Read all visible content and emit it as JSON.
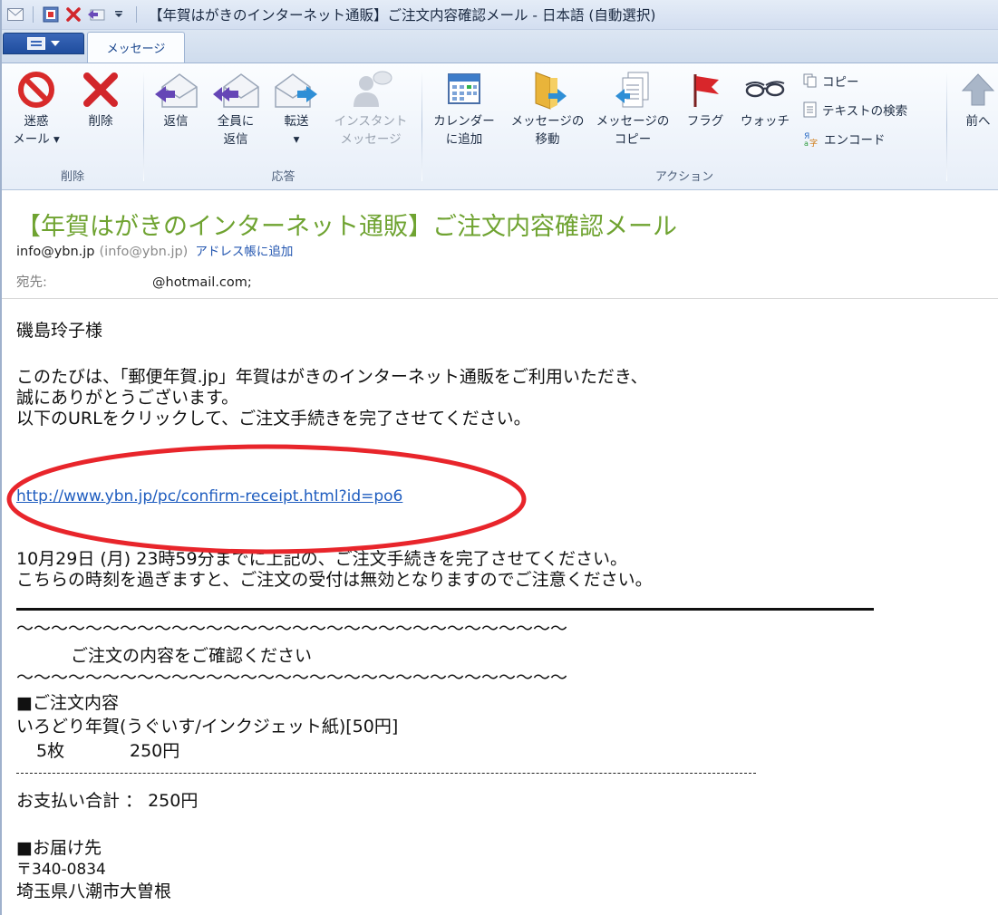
{
  "window": {
    "title": "【年賀はがきのインターネット通販】ご注文内容確認メール - 日本語 (自動選択)"
  },
  "tabs": {
    "message_tab": "メッセージ"
  },
  "ribbon": {
    "groups": {
      "delete": "削除",
      "respond": "応答",
      "actions": "アクション"
    },
    "buttons": {
      "junk_line1": "迷惑",
      "junk_line2": "メール ▾",
      "delete": "削除",
      "reply": "返信",
      "reply_all_line1": "全員に",
      "reply_all_line2": "返信",
      "forward_line1": "転送",
      "forward_line2": "▾",
      "im_line1": "インスタント",
      "im_line2": "メッセージ",
      "calendar_line1": "カレンダー",
      "calendar_line2": "に追加",
      "move_line1": "メッセージの",
      "move_line2": "移動",
      "copy_msg_line1": "メッセージの",
      "copy_msg_line2": "コピー",
      "flag": "フラグ",
      "watch": "ウォッチ",
      "copy": "コピー",
      "find_text": "テキストの検索",
      "encode": "エンコード",
      "prev": "前へ"
    }
  },
  "header": {
    "subject": "【年賀はがきのインターネット通販】ご注文内容確認メール",
    "from_address": "info@ybn.jp",
    "from_alt": "(info@ybn.jp)",
    "add_to_contacts": "アドレス帳に追加",
    "to_label": "宛先:",
    "to_value": "@hotmail.com;"
  },
  "body": {
    "greeting": "磯島玲子様",
    "intro1": "このたびは、「郵便年賀.jp」年賀はがきのインターネット通販をご利用いただき、",
    "intro2": "誠にありがとうございます。",
    "intro3": "以下のURLをクリックして、ご注文手続きを完了させてください。",
    "link": "http://www.ybn.jp/pc/confirm-receipt.html?id=po6",
    "deadline1": "10月29日 (月) 23時59分までに上記の、ご注文手続きを完了させてください。",
    "deadline2": "こちらの時刻を過ぎますと、ご注文の受付は無効となりますのでご注意ください。",
    "wave": "～～～～～～～～～～～～～～～～～～～～～～～～～～～～～～～～",
    "confirm_heading": "ご注文の内容をご確認ください",
    "order_heading": "■ご注文内容",
    "order_item": "いろどり年賀(うぐいす/インクジェット紙)[50円]",
    "order_qty": "5枚",
    "order_price": "250円",
    "total": "お支払い合計 ： 250円",
    "delivery_heading": "■お届け先",
    "postal": "〒340-0834",
    "address": "埼玉県八潮市大曽根"
  },
  "colors": {
    "subject_green": "#6fa331",
    "link_blue": "#1f5dbf",
    "highlight_red": "#e8252b"
  }
}
